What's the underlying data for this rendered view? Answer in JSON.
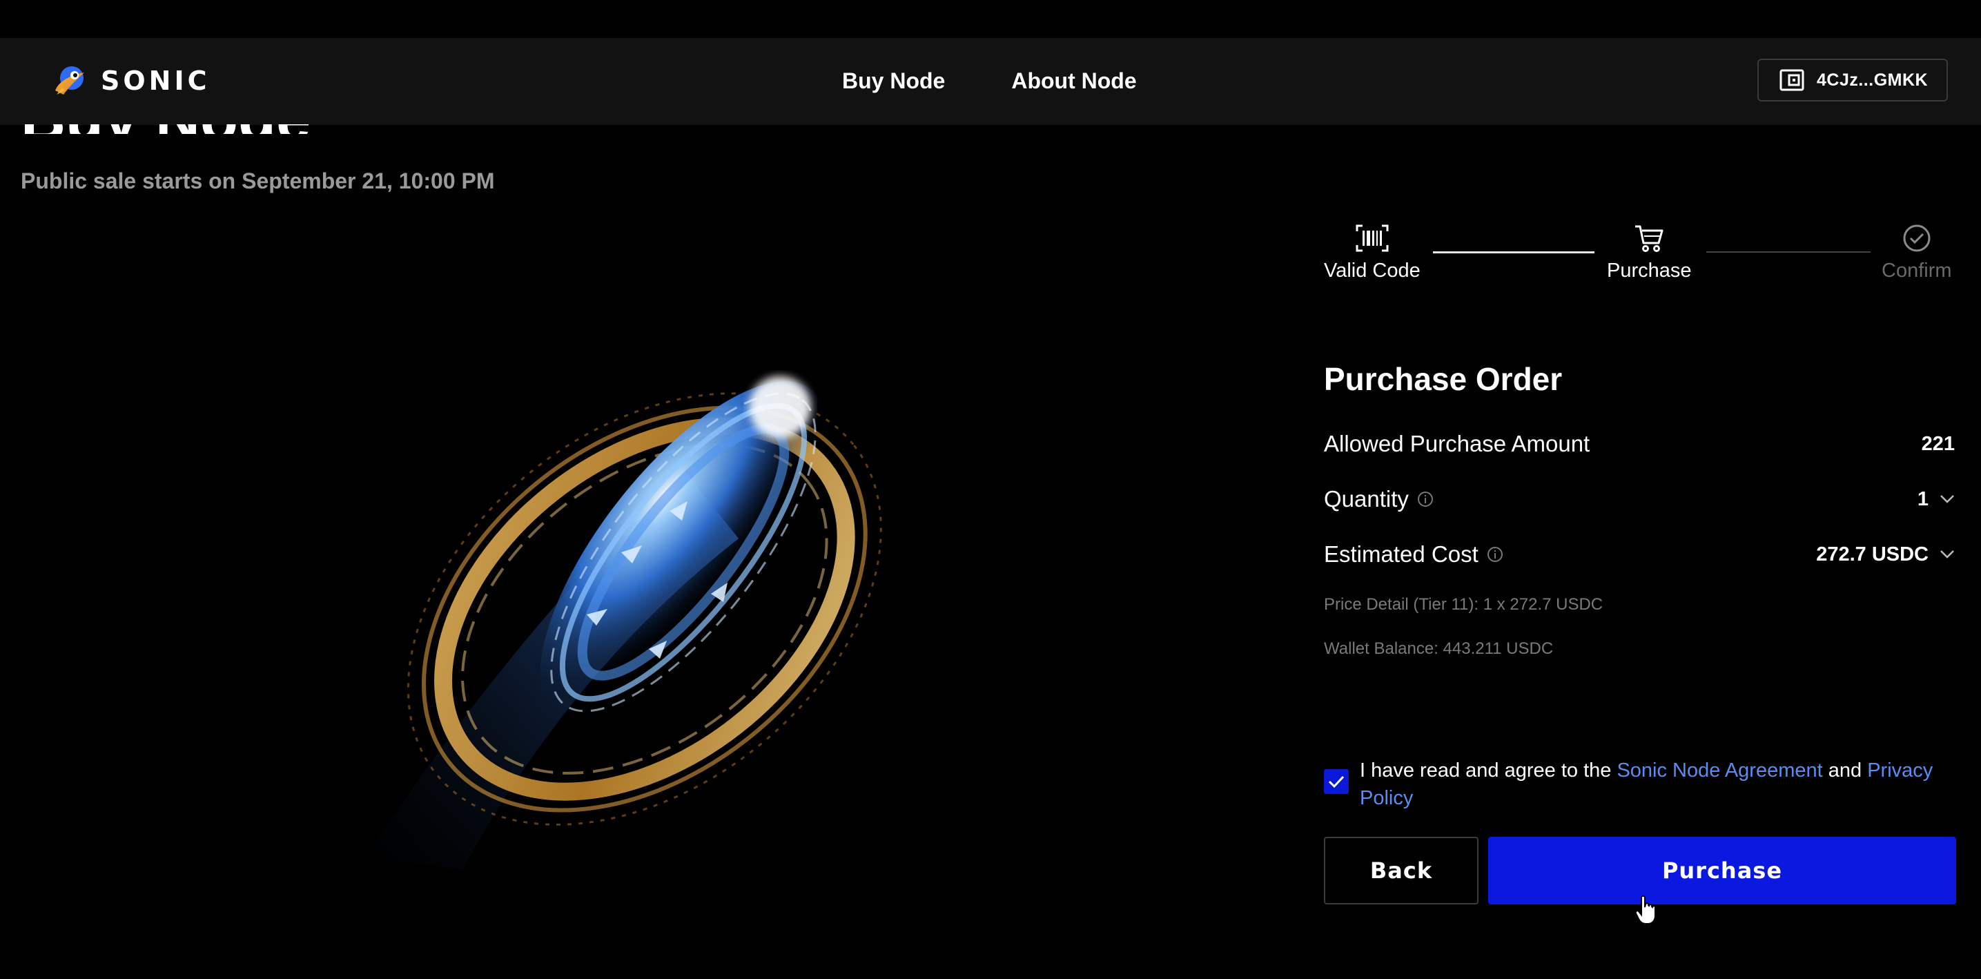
{
  "header": {
    "brand": "SONIC",
    "nav": [
      "Buy Node",
      "About Node"
    ],
    "wallet_address": "4CJz...GMKK"
  },
  "hero": {
    "clipped_title": "Buy Node",
    "sale_note": "Public sale starts on September 21, 10:00 PM"
  },
  "stepper": {
    "steps": [
      {
        "label": "Valid Code",
        "icon": "barcode-icon",
        "state": "done"
      },
      {
        "label": "Purchase",
        "icon": "cart-icon",
        "state": "active"
      },
      {
        "label": "Confirm",
        "icon": "check-circle-icon",
        "state": "pending"
      }
    ]
  },
  "order": {
    "title": "Purchase Order",
    "allowed_label": "Allowed Purchase Amount",
    "allowed_value": "221",
    "quantity_label": "Quantity",
    "quantity_value": "1",
    "cost_label": "Estimated Cost",
    "cost_value": "272.7 USDC",
    "price_detail": "Price Detail (Tier 11): 1 x 272.7 USDC",
    "wallet_balance": "Wallet Balance: 443.211 USDC"
  },
  "agreement": {
    "checked": true,
    "prefix": "I have read and agree to the ",
    "link1": "Sonic Node Agreement",
    "middle": " and ",
    "link2": "Privacy Policy"
  },
  "buttons": {
    "back": "Back",
    "purchase": "Purchase"
  },
  "colors": {
    "accent": "#0a18e0",
    "link": "#5b8cf0",
    "muted": "#9a9a9a",
    "header_bg": "#121212"
  }
}
